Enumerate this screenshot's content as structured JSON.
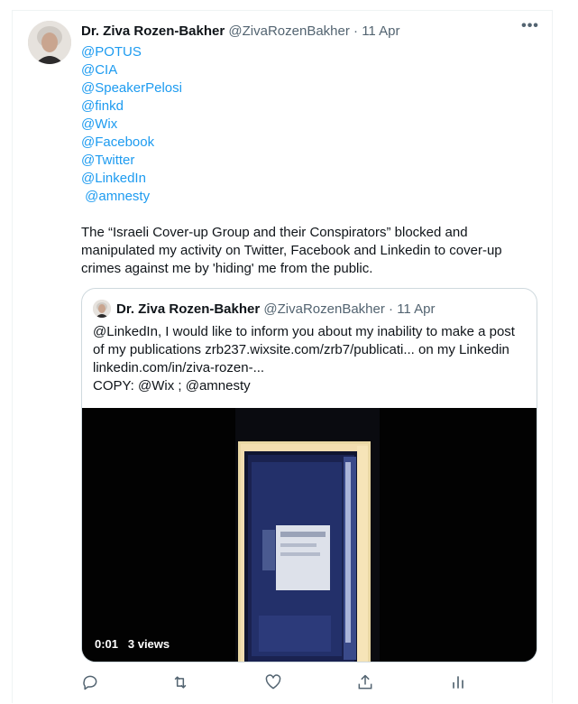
{
  "tweet": {
    "author_name": "Dr. Ziva Rozen-Bakher",
    "handle": "@ZivaRozenBakher",
    "separator": " · ",
    "date": "11 Apr",
    "mentions": [
      "@POTUS",
      "@CIA",
      "@SpeakerPelosi",
      "@finkd",
      "@Wix",
      "@Facebook",
      "@Twitter",
      "@LinkedIn",
      " @amnesty"
    ],
    "text": "The “Israeli Cover-up Group and their Conspirators” blocked and manipulated my activity on Twitter, Facebook and Linkedin to cover-up crimes against me by 'hiding' me from the public."
  },
  "quoted": {
    "author_name": "Dr. Ziva Rozen-Bakher",
    "handle": "@ZivaRozenBakher",
    "separator": " · ",
    "date": "11 Apr",
    "lines": [
      "@LinkedIn, I would like to inform you about my inability to make a post",
      "of my publications zrb237.wixsite.com/zrb7/publicati... on my Linkedin",
      "linkedin.com/in/ziva-rozen-...",
      "COPY: @Wix ; @amnesty"
    ],
    "video": {
      "time": "0:01",
      "views": "3 views"
    }
  },
  "icons": {
    "more": "more-horizontal-icon",
    "reply": "reply-icon",
    "retweet": "retweet-icon",
    "like": "like-icon",
    "share": "share-icon",
    "analytics": "analytics-icon"
  },
  "colors": {
    "link": "#1d9bf0",
    "muted": "#536471",
    "text": "#0f1419",
    "border": "#cfd9de"
  }
}
